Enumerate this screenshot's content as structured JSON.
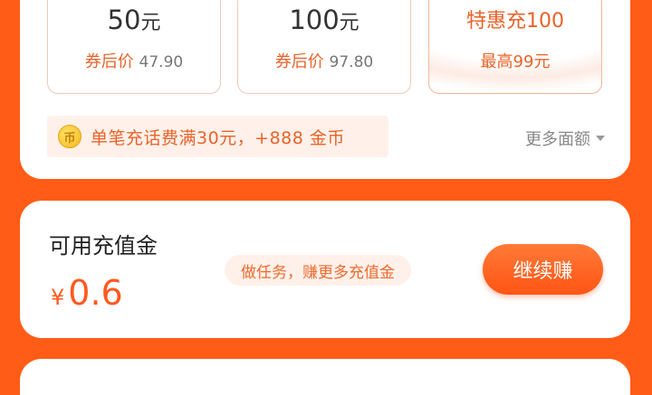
{
  "options": [
    {
      "amount": "50",
      "unit": "元",
      "sub_label": "券后价",
      "sub_price": "47.90"
    },
    {
      "amount": "100",
      "unit": "元",
      "sub_label": "券后价",
      "sub_price": "97.80"
    },
    {
      "title": "特惠充100",
      "sub": "最高99元"
    }
  ],
  "promo": {
    "coin_icon": "coin-icon",
    "text": "单笔充话费满30元，+888 金币"
  },
  "more": {
    "label": "更多面额"
  },
  "balance": {
    "label": "可用充值金",
    "currency": "¥",
    "value": "0.6"
  },
  "task": {
    "label": "做任务，赚更多充值金"
  },
  "earn_button": {
    "label": "继续赚"
  },
  "colors": {
    "accent": "#ff5c17",
    "highlight": "#e8632a"
  }
}
